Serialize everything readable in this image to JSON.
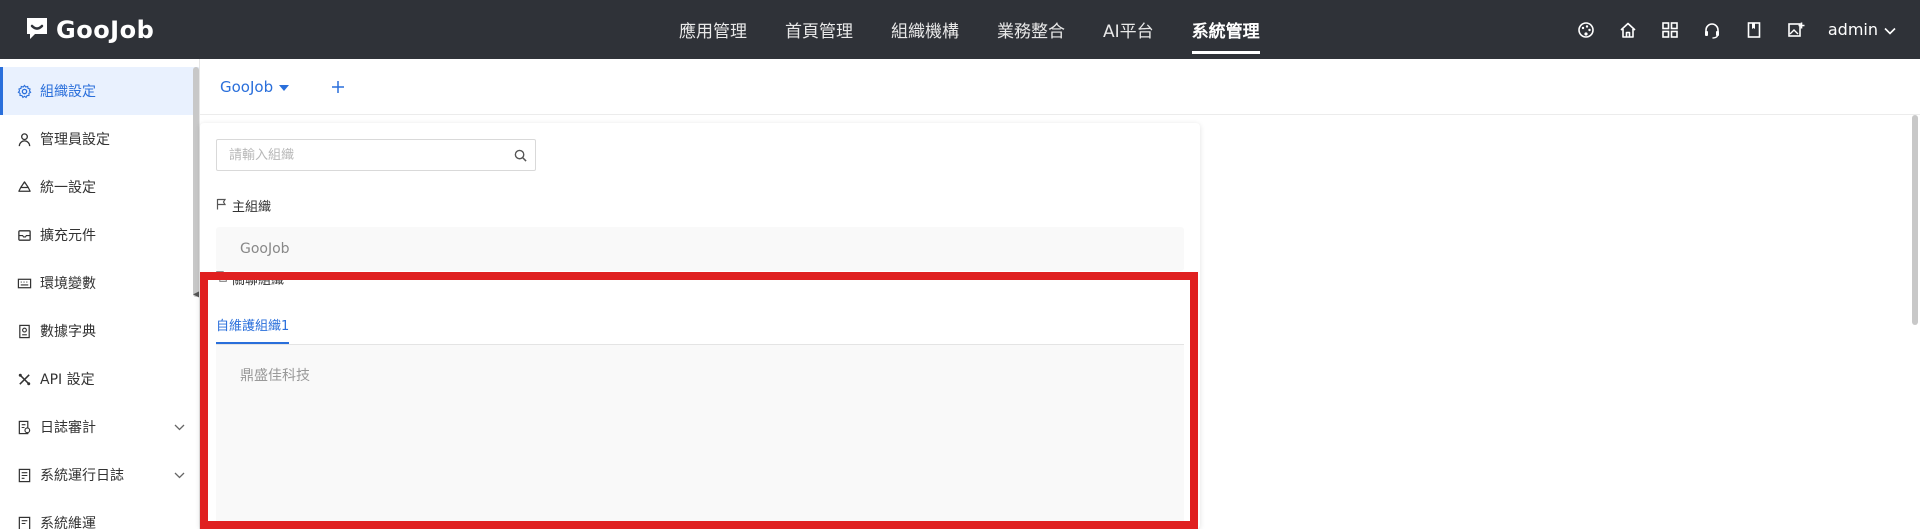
{
  "brand": {
    "name": "GooJob"
  },
  "nav": {
    "items": [
      {
        "label": "應用管理"
      },
      {
        "label": "首頁管理"
      },
      {
        "label": "組織機構"
      },
      {
        "label": "業務整合"
      },
      {
        "label": "AI平台"
      },
      {
        "label": "系統管理"
      }
    ],
    "active_index": 5
  },
  "toolbar": {
    "icons": [
      "palette-icon",
      "home-icon",
      "grid-icon",
      "headset-icon",
      "book-icon",
      "image-add-icon"
    ],
    "user_label": "admin"
  },
  "sidebar": {
    "items": [
      {
        "label": "組織設定",
        "icon": "gear-icon"
      },
      {
        "label": "管理員設定",
        "icon": "user-icon"
      },
      {
        "label": "統一設定",
        "icon": "recycle-icon"
      },
      {
        "label": "擴充元件",
        "icon": "box-icon"
      },
      {
        "label": "環境變數",
        "icon": "keyboard-icon"
      },
      {
        "label": "數據字典",
        "icon": "dictionary-icon"
      },
      {
        "label": "API 設定",
        "icon": "tools-icon"
      },
      {
        "label": "日誌審計",
        "icon": "audit-icon"
      },
      {
        "label": "系統運行日誌",
        "icon": "log-icon"
      },
      {
        "label": "系統維運",
        "icon": "maintenance-icon"
      }
    ],
    "active_index": 0
  },
  "main": {
    "org_switch_label": "GooJob",
    "search": {
      "placeholder": "請輸入組織",
      "value": ""
    },
    "primary_section": {
      "title": "主組織",
      "org_name": "GooJob"
    },
    "related_section": {
      "title": "關聯組織",
      "tab_label": "自維護組織1",
      "items": [
        "鼎盛佳科技"
      ]
    }
  },
  "colors": {
    "accent": "#2a6fdb",
    "topbar": "#2f3238",
    "highlight": "#e02020"
  }
}
